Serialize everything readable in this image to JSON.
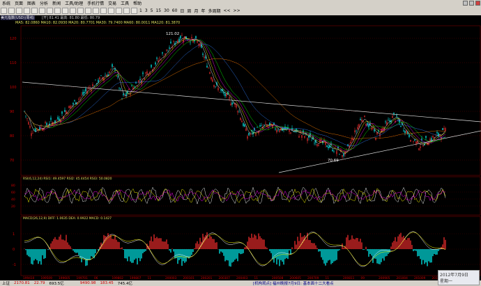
{
  "menu": {
    "items": [
      "系统",
      "页面",
      "图表",
      "分析",
      "新闻",
      "工具/助理",
      "手机行情",
      "交易",
      "工具",
      "帮助"
    ]
  },
  "toolbar": {
    "periods": [
      "1",
      "3",
      "5",
      "15",
      "30",
      "60",
      "日",
      "周",
      "月",
      "年"
    ],
    "extra": [
      "多周期",
      "<<",
      ">>"
    ]
  },
  "header": {
    "instrument": "美元指数(USD)(周线)",
    "ma_line": "MA5: 82.0860  MA10: 82.0930  MA20: 80.7701  MA30: 79.7400  MA60: 80.0011  MA120: 81.3870",
    "ohlc_line": "[开] 81.41  最高: 81.80  最低: 80.79"
  },
  "main_chart": {
    "y_ticks": [
      "120",
      "110",
      "100",
      "90",
      "80",
      "70"
    ],
    "high_label": "121.02",
    "low_label": "70.69"
  },
  "rsi": {
    "header": "RSI(6,12,24)  RSI1: 49.4597  RSI2: 45.4454  RSI3: 50.0820",
    "y_ticks": [
      "80",
      "60",
      "40",
      "20"
    ]
  },
  "macd": {
    "header": "MACD(26,12,9)  DIFF: 1.0635  DEA: 0.9922  MACD: 0.1427",
    "y_ticks": [
      "1",
      "0",
      "-1"
    ]
  },
  "x_axis": {
    "labels": [
      "199410",
      "199509",
      "199605",
      "199701",
      "06",
      "199802",
      "199807",
      "11",
      "200003",
      "200101",
      "200201",
      "200307",
      "200403",
      "11",
      "200508",
      "200605",
      "200709",
      "11",
      "200811",
      "09",
      "200905",
      "201004",
      "201009",
      "201105",
      "201201"
    ]
  },
  "status": {
    "index1": "上证",
    "value1": "2170.81",
    "chg1": "22.79",
    "amt1": "693.5亿",
    "value2": "9490.98",
    "chg2": "183.45",
    "amt2": "745.4亿",
    "news": "[机构观点] 福州晚报7月9日: 基本面十二大看点"
  },
  "date_box": {
    "date": "2012年7月9日",
    "weekday": "星期一"
  },
  "colors": {
    "up": "#ff3030",
    "down": "#00ffff",
    "grid": "#7a0000",
    "axis": "#aa0000"
  }
}
